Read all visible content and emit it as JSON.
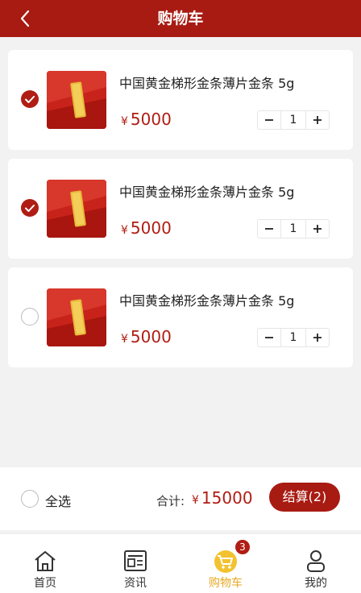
{
  "header": {
    "title": "购物车"
  },
  "cart": {
    "items": [
      {
        "name": "中国黄金梯形金条薄片金条 5g",
        "currency": "¥",
        "price": "5000",
        "qty": "1",
        "checked": true
      },
      {
        "name": "中国黄金梯形金条薄片金条 5g",
        "currency": "¥",
        "price": "5000",
        "qty": "1",
        "checked": true
      },
      {
        "name": "中国黄金梯形金条薄片金条 5g",
        "currency": "¥",
        "price": "5000",
        "qty": "1",
        "checked": false
      }
    ]
  },
  "summary": {
    "select_all": "全选",
    "total_label": "合计:",
    "currency": "¥",
    "total": "15000",
    "checkout": "结算(2)"
  },
  "tabbar": {
    "tabs": [
      {
        "label": "首页",
        "icon": "home-icon"
      },
      {
        "label": "资讯",
        "icon": "news-icon"
      },
      {
        "label": "购物车",
        "icon": "cart-icon",
        "active": true
      },
      {
        "label": "我的",
        "icon": "user-icon"
      }
    ],
    "cart_badge": "3"
  },
  "colors": {
    "brand": "#a81b12",
    "price": "#b01d14",
    "active_tab": "#e5a821"
  }
}
